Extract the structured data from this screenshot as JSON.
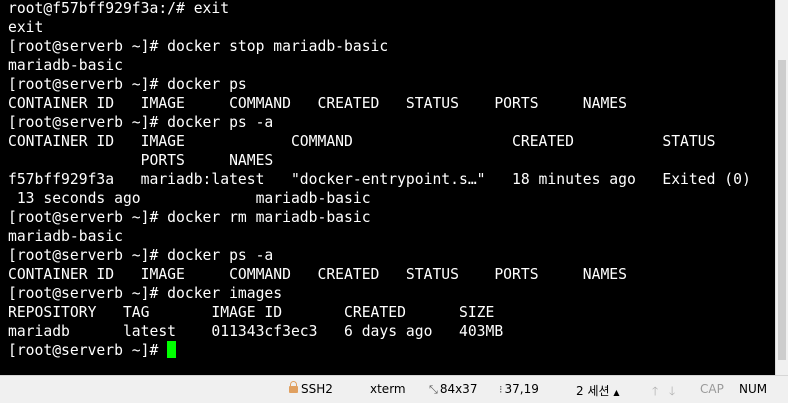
{
  "terminal": {
    "lines": [
      "root@f57bff929f3a:/# exit",
      "exit",
      "[root@serverb ~]# docker stop mariadb-basic",
      "mariadb-basic",
      "[root@serverb ~]# docker ps",
      "CONTAINER ID   IMAGE     COMMAND   CREATED   STATUS    PORTS     NAMES",
      "[root@serverb ~]# docker ps -a",
      "CONTAINER ID   IMAGE            COMMAND                  CREATED          STATUS",
      "               PORTS     NAMES",
      "f57bff929f3a   mariadb:latest   \"docker-entrypoint.s…\"   18 minutes ago   Exited (0)",
      " 13 seconds ago             mariadb-basic",
      "[root@serverb ~]# docker rm mariadb-basic",
      "mariadb-basic",
      "[root@serverb ~]# docker ps -a",
      "CONTAINER ID   IMAGE     COMMAND   CREATED   STATUS    PORTS     NAMES",
      "[root@serverb ~]# docker images",
      "REPOSITORY   TAG       IMAGE ID       CREATED      SIZE",
      "mariadb      latest    011343cf3ec3   6 days ago   403MB"
    ],
    "prompt": "[root@serverb ~]#",
    "cursor_color": "#00ff00"
  },
  "statusbar": {
    "protocol": "SSH2",
    "terminal_type": "xterm",
    "size": "84x37",
    "cursor_pos": "37,19",
    "sessions": "2 세션",
    "caps": "CAP",
    "num": "NUM"
  }
}
